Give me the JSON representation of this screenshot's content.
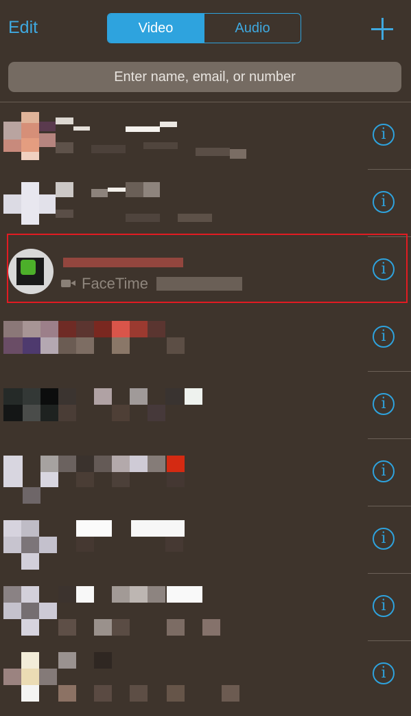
{
  "header": {
    "edit_label": "Edit",
    "segments": [
      {
        "label": "Video",
        "selected": true
      },
      {
        "label": "Audio",
        "selected": false
      }
    ],
    "add_icon": "plus-icon"
  },
  "search": {
    "placeholder": "Enter name, email, or number"
  },
  "contacts": {
    "highlighted_subtitle": "FaceTime",
    "info_icon": "info-icon",
    "row_count": 9
  },
  "colors": {
    "background": "#3e342c",
    "accent": "#2ea3de",
    "highlight_border": "#e21b22"
  }
}
